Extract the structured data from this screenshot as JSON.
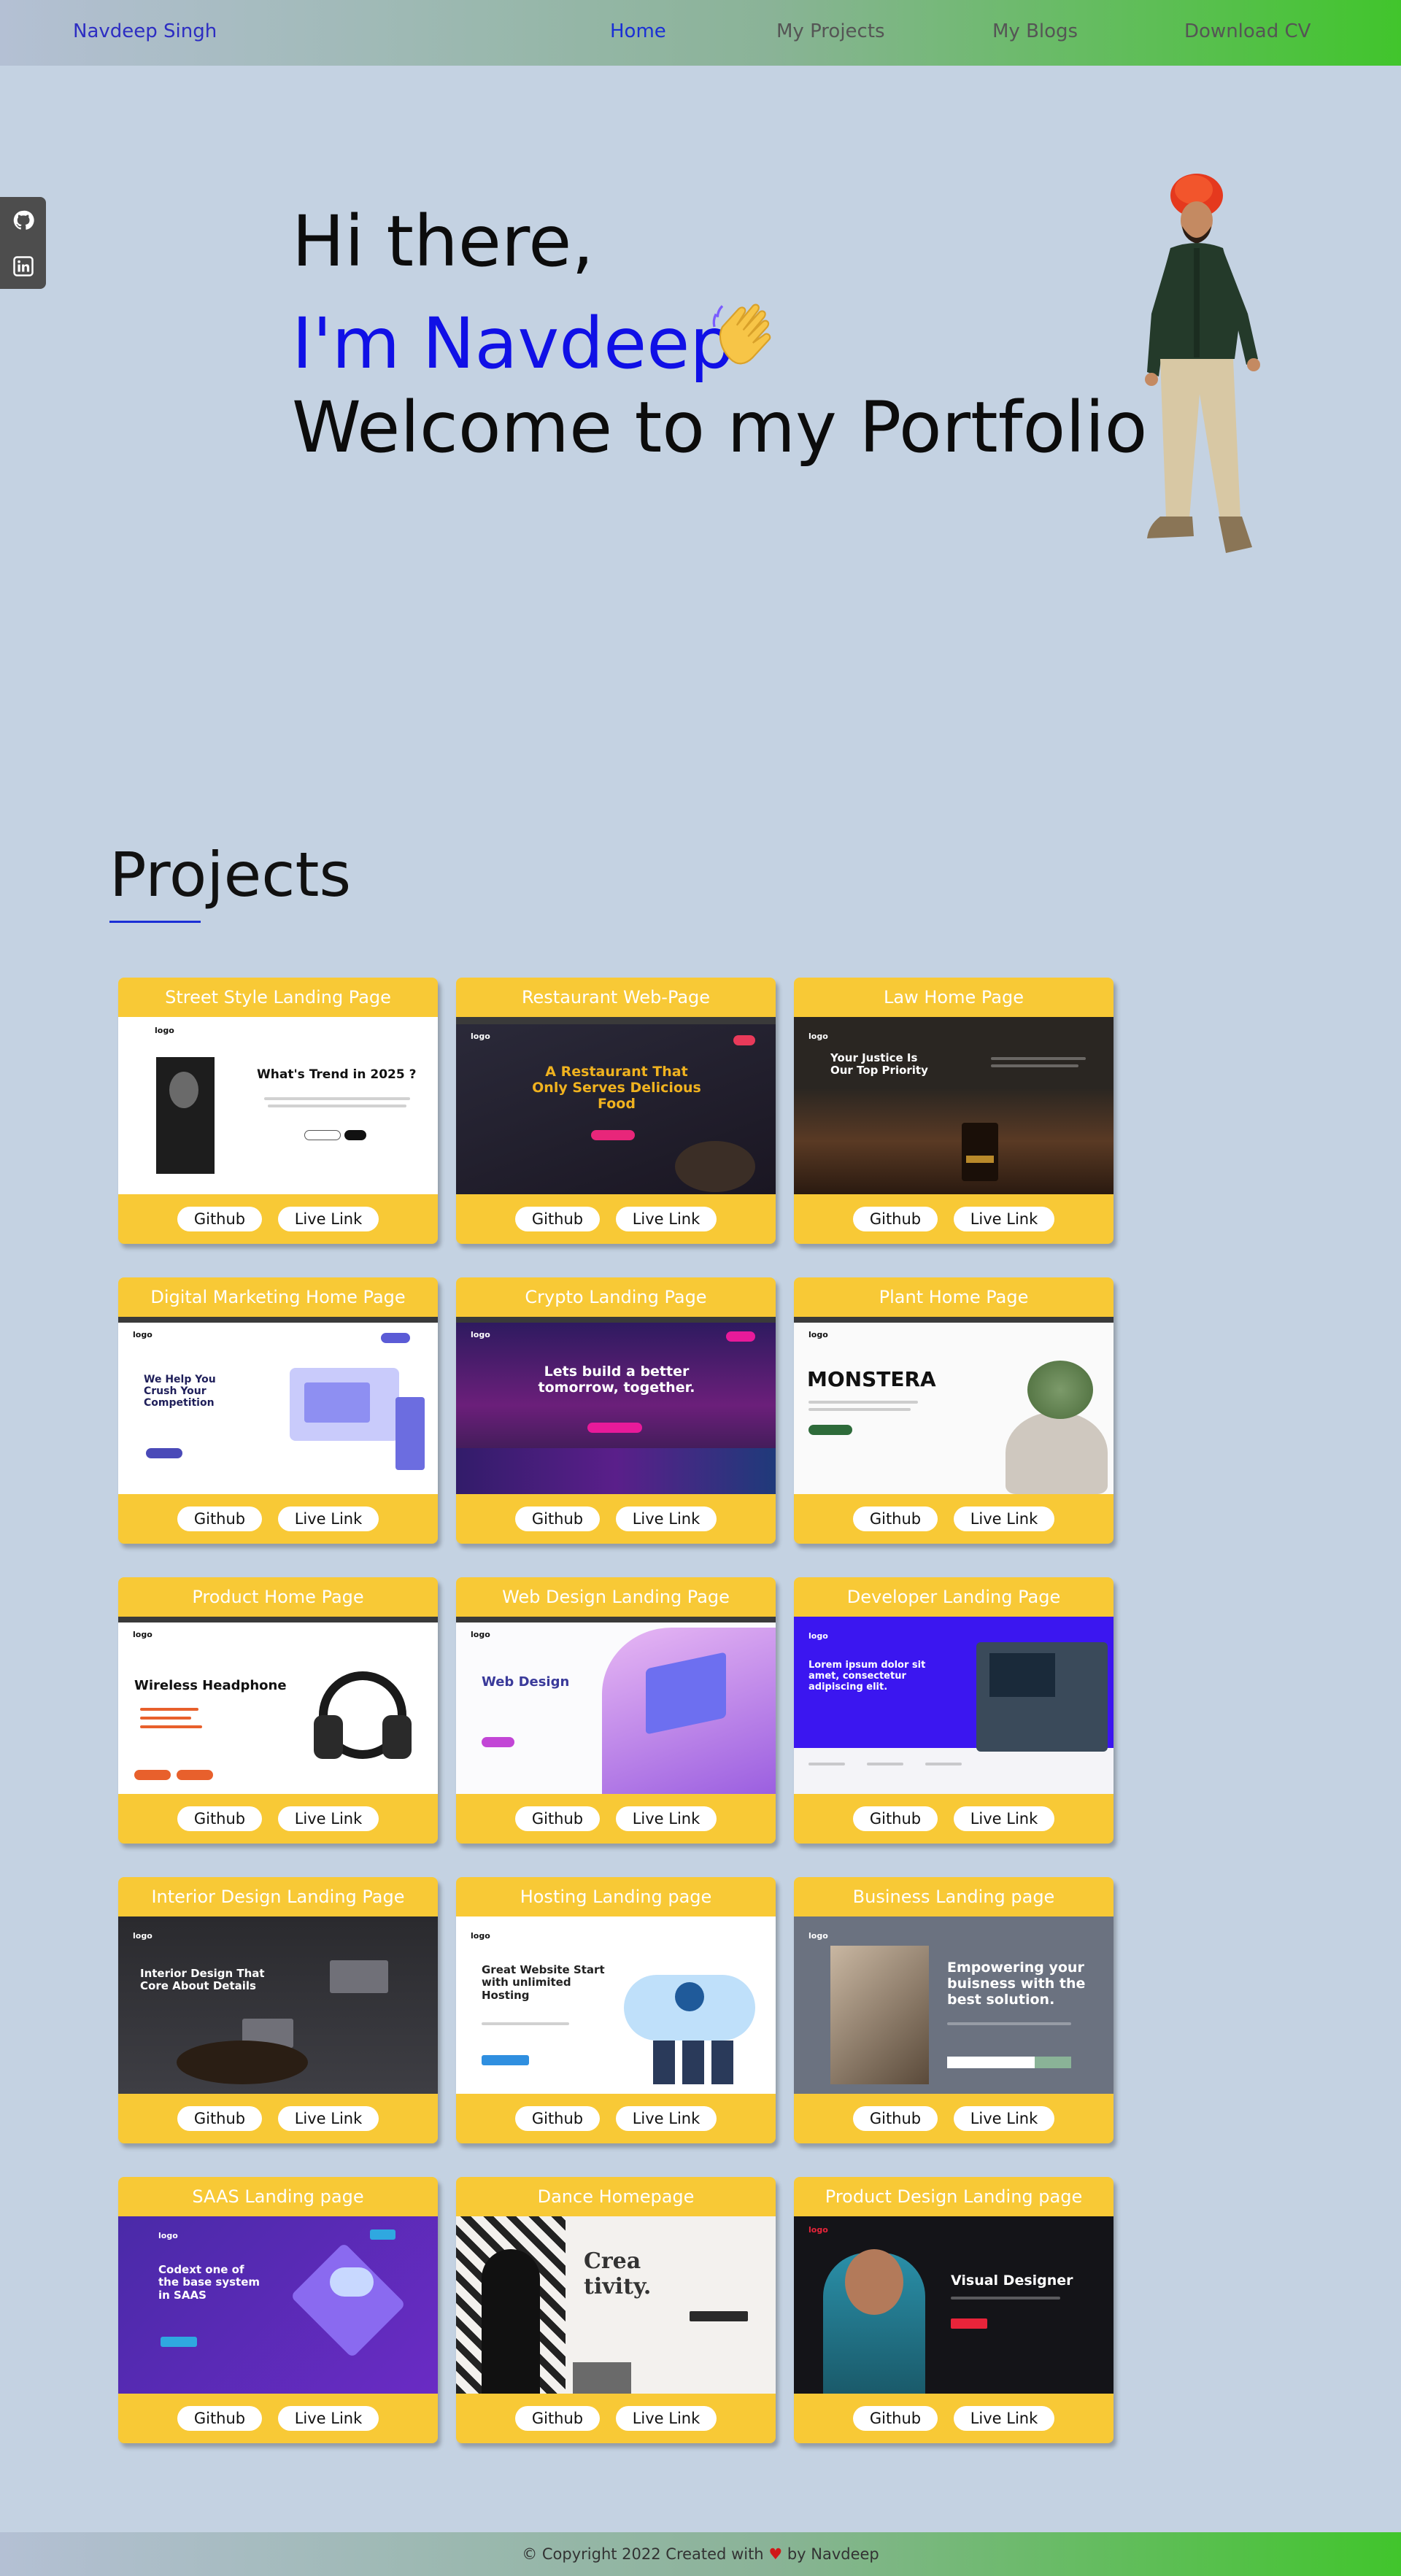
{
  "navbar": {
    "brand": "Navdeep Singh",
    "links": [
      "Home",
      "My Projects",
      "My Blogs",
      "Download CV"
    ]
  },
  "social": {
    "icons": [
      "github-icon",
      "linkedin-icon"
    ]
  },
  "hero": {
    "line1": "Hi there,",
    "line2": "I'm Navdeep",
    "line3": "Welcome to my Portfolio"
  },
  "projects": {
    "title": "Projects",
    "github_label": "Github",
    "live_label": "Live Link",
    "items": [
      {
        "title": "Street Style Landing Page",
        "shot": {
          "heading": "What's Trend in 2025 ?",
          "logo": "logo"
        }
      },
      {
        "title": "Restaurant Web-Page",
        "shot": {
          "heading": "A Restaurant That Only Serves Delicious Food",
          "logo": "logo"
        }
      },
      {
        "title": "Law Home Page",
        "shot": {
          "heading": "Your Justice Is Our Top Priority",
          "logo": "logo"
        }
      },
      {
        "title": "Digital Marketing Home Page",
        "shot": {
          "heading": "We Help You Crush Your Competition",
          "logo": "logo"
        }
      },
      {
        "title": "Crypto Landing Page",
        "shot": {
          "heading": "Lets build a better tomorrow, together.",
          "logo": "logo"
        }
      },
      {
        "title": "Plant Home Page",
        "shot": {
          "heading": "MONSTERA",
          "logo": "logo"
        }
      },
      {
        "title": "Product Home Page",
        "shot": {
          "heading": "Wireless Headphone",
          "logo": "logo"
        }
      },
      {
        "title": "Web Design Landing Page",
        "shot": {
          "heading": "Web Design",
          "logo": "logo"
        }
      },
      {
        "title": "Developer Landing Page",
        "shot": {
          "heading": "Lorem ipsum dolor sit amet, consectetur adipiscing elit.",
          "logo": "logo"
        }
      },
      {
        "title": "Interior Design Landing Page",
        "shot": {
          "heading": "Interior Design That Core About Details",
          "logo": "logo"
        }
      },
      {
        "title": "Hosting Landing page",
        "shot": {
          "heading": "Great Website Start with unlimited Hosting",
          "logo": "logo"
        }
      },
      {
        "title": "Business Landing page",
        "shot": {
          "heading": "Empowering your buisness with the best solution.",
          "logo": "logo"
        }
      },
      {
        "title": "SAAS Landing page",
        "shot": {
          "heading": "Codext one of the base system in SAAS",
          "logo": "logo"
        }
      },
      {
        "title": "Dance Homepage",
        "shot": {
          "heading": "Crea tivity.",
          "logo": ""
        }
      },
      {
        "title": "Product Design Landing page",
        "shot": {
          "heading": "Visual Designer",
          "logo": "logo"
        }
      }
    ]
  },
  "footer": {
    "copy": "© Copyright 2022 Created with",
    "heart": "♥",
    "by": "by Navdeep"
  }
}
